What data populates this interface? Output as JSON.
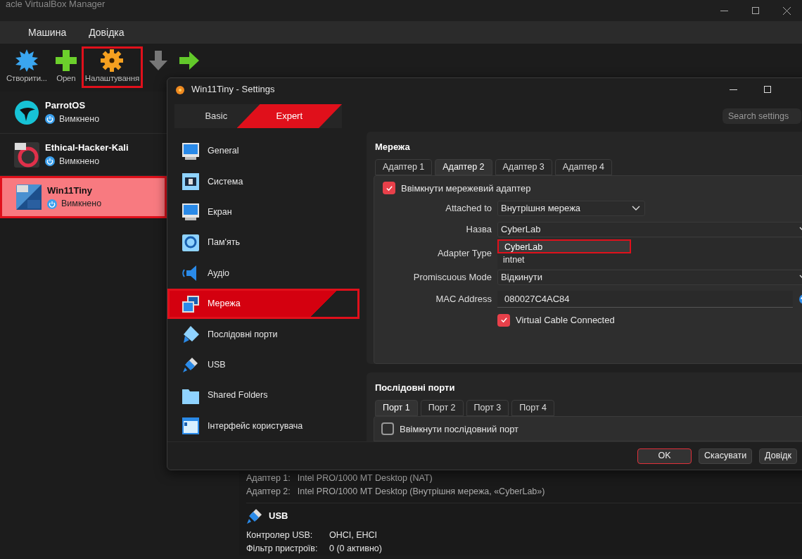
{
  "window": {
    "title": "acle VirtualBox Manager"
  },
  "menu": [
    {
      "label": "Машина"
    },
    {
      "label": "Довідка"
    }
  ],
  "toolbar": [
    {
      "kind": "new",
      "label": "Створити...",
      "highlighted": false
    },
    {
      "kind": "add",
      "label": "Open",
      "highlighted": false
    },
    {
      "kind": "settings",
      "label": "Налаштування",
      "highlighted": true
    },
    {
      "kind": "discard",
      "highlighted": false
    },
    {
      "kind": "start",
      "highlighted": false
    }
  ],
  "vms": [
    {
      "kind": "parrot",
      "name": "ParrotOS",
      "status": "Вимкнено",
      "selected": false
    },
    {
      "kind": "debian",
      "name": "Ethical-Hacker-Kali",
      "status": "Вимкнено",
      "selected": false
    },
    {
      "kind": "windows",
      "name": "Win11Tiny",
      "status": "Вимкнено",
      "selected": true
    }
  ],
  "details": {
    "adapters": [
      {
        "label": "Адаптер 1:",
        "value": "Intel PRO/1000 MT Desktop (NAT)"
      },
      {
        "label": "Адаптер 2:",
        "value": "Intel PRO/1000 MT Desktop (Внутрішня мережа, «CyberLab»)"
      }
    ],
    "usb": {
      "title": "USB",
      "rows": [
        {
          "label": "Контролер USB:",
          "value": "OHCI, EHCI"
        },
        {
          "label": "Фільтр пристроїв:",
          "value": "0 (0 активно)"
        }
      ]
    }
  },
  "dialog": {
    "title": "Win11Tiny - Settings",
    "modes": [
      {
        "label": "Basic",
        "selected": false
      },
      {
        "label": "Expert",
        "selected": true
      }
    ],
    "search": {
      "placeholder": "Search settings"
    },
    "nav": [
      {
        "kind": "general",
        "label": "General",
        "selected": false
      },
      {
        "kind": "system",
        "label": "Система",
        "selected": false
      },
      {
        "kind": "display",
        "label": "Екран",
        "selected": false
      },
      {
        "kind": "storage",
        "label": "Пам'ять",
        "selected": false
      },
      {
        "kind": "audio",
        "label": "Аудіо",
        "selected": false
      },
      {
        "kind": "network",
        "label": "Мережа",
        "selected": true
      },
      {
        "kind": "serial",
        "label": "Послідовні порти",
        "selected": false
      },
      {
        "kind": "usb",
        "label": "USB",
        "selected": false
      },
      {
        "kind": "folder",
        "label": "Shared Folders",
        "selected": false
      },
      {
        "kind": "ui",
        "label": "Інтерфейс користувача",
        "selected": false
      }
    ],
    "network": {
      "title": "Мережа",
      "tabs": [
        {
          "label": "Адаптер 1",
          "selected": false
        },
        {
          "label": "Адаптер 2",
          "selected": true
        },
        {
          "label": "Адаптер 3",
          "selected": false
        },
        {
          "label": "Адаптер 4",
          "selected": false
        }
      ],
      "enable": {
        "label": "Ввімкнути мережевий адаптер",
        "checked": true
      },
      "attached_to": {
        "label": "Attached to",
        "value": "Внутрішня мережа"
      },
      "name": {
        "label": "Назва",
        "value": "CyberLab"
      },
      "name_options": [
        {
          "label": "CyberLab",
          "highlighted": true
        },
        {
          "label": "intnet",
          "highlighted": false
        }
      ],
      "adapter_type": {
        "label": "Adapter Type"
      },
      "promiscuous": {
        "label": "Promiscuous Mode",
        "value": "Відкинути"
      },
      "mac": {
        "label": "MAC Address",
        "value": "080027C4AC84"
      },
      "cable": {
        "label": "Virtual Cable Connected",
        "checked": true
      }
    },
    "serial": {
      "title": "Послідовні порти",
      "tabs": [
        {
          "label": "Порт 1",
          "selected": true
        },
        {
          "label": "Порт 2",
          "selected": false
        },
        {
          "label": "Порт 3",
          "selected": false
        },
        {
          "label": "Порт 4",
          "selected": false
        }
      ],
      "enable": {
        "label": "Ввімкнути послідовний порт",
        "checked": false
      }
    },
    "buttons": [
      {
        "kind": "default",
        "label": "OK"
      },
      {
        "kind": "normal",
        "label": "Скасувати"
      },
      {
        "kind": "normal",
        "label": "Довідк"
      }
    ]
  }
}
